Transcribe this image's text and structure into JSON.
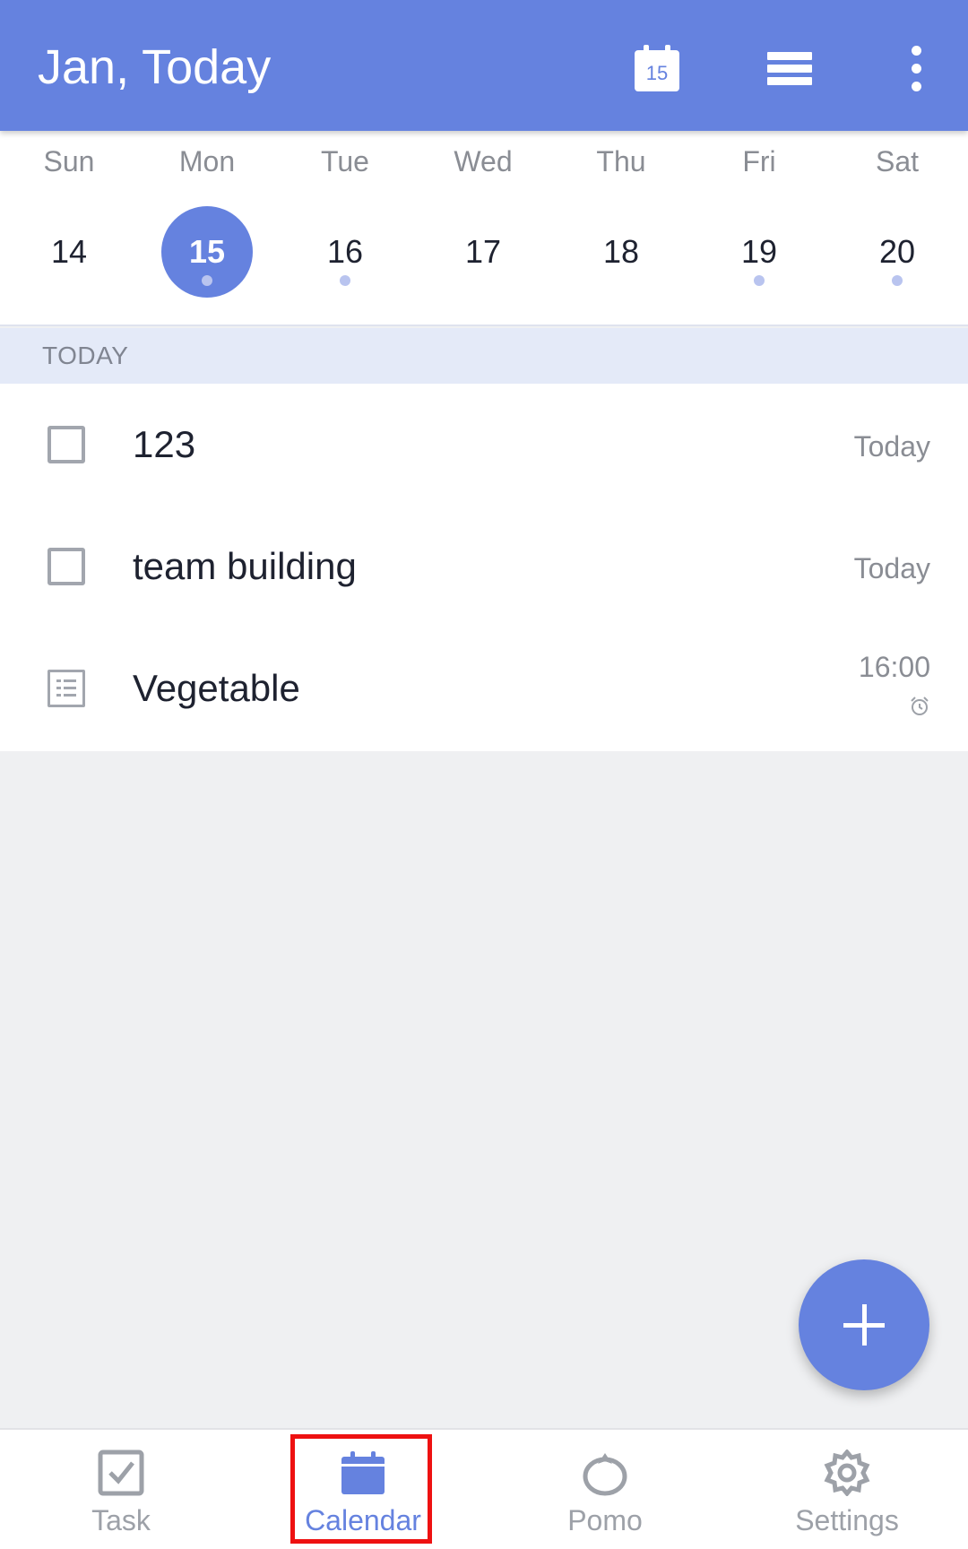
{
  "appbar": {
    "title": "Jan, Today",
    "today_icon_day": "15",
    "icons": [
      "calendar-today-icon",
      "view-mode-icon",
      "more-vert-icon"
    ]
  },
  "week": {
    "days": [
      {
        "name": "Sun",
        "num": "14",
        "has_event": false,
        "selected": false
      },
      {
        "name": "Mon",
        "num": "15",
        "has_event": true,
        "selected": true
      },
      {
        "name": "Tue",
        "num": "16",
        "has_event": true,
        "selected": false
      },
      {
        "name": "Wed",
        "num": "17",
        "has_event": false,
        "selected": false
      },
      {
        "name": "Thu",
        "num": "18",
        "has_event": false,
        "selected": false
      },
      {
        "name": "Fri",
        "num": "19",
        "has_event": true,
        "selected": false
      },
      {
        "name": "Sat",
        "num": "20",
        "has_event": true,
        "selected": false
      }
    ]
  },
  "section": {
    "label": "TODAY"
  },
  "tasks": [
    {
      "title": "123",
      "date": "Today",
      "type": "checkbox"
    },
    {
      "title": "team building",
      "date": "Today",
      "type": "checkbox"
    },
    {
      "title": "Vegetable",
      "date": "16:00",
      "type": "note",
      "has_alarm": true
    }
  ],
  "nav": {
    "items": [
      {
        "label": "Task",
        "icon": "task-icon",
        "active": false
      },
      {
        "label": "Calendar",
        "icon": "calendar-icon",
        "active": true
      },
      {
        "label": "Pomo",
        "icon": "pomo-icon",
        "active": false
      },
      {
        "label": "Settings",
        "icon": "settings-icon",
        "active": false
      }
    ]
  },
  "colors": {
    "accent": "#6582df",
    "highlight": "#ee1111"
  }
}
